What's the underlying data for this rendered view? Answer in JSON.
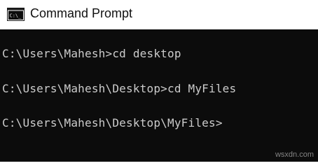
{
  "window": {
    "title": "Command Prompt",
    "icon": "cmd-icon"
  },
  "console": {
    "lines": [
      "C:\\Users\\Mahesh>cd desktop",
      "C:\\Users\\Mahesh\\Desktop>cd MyFiles",
      "C:\\Users\\Mahesh\\Desktop\\MyFiles>"
    ],
    "background": "#0c0c0c",
    "foreground": "#cccccc"
  },
  "watermark": "wsxdn.com"
}
